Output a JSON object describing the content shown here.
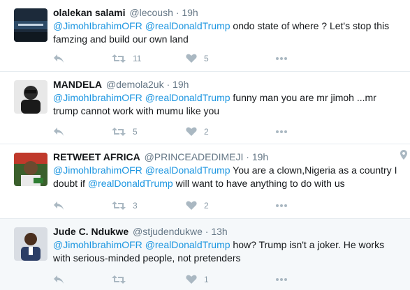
{
  "tweets": [
    {
      "name": "olalekan salami",
      "handle": "@lecoush",
      "time": "19h",
      "mention1": "@JimohIbrahimOFR",
      "mention2": "@realDonaldTrump",
      "text_a": " ondo state of where ? Let's stop this famzing and build our own land",
      "text_b": "",
      "mention3": "",
      "text_c": "",
      "retweets": "11",
      "likes": "5"
    },
    {
      "name": "MANDELA",
      "handle": "@demola2uk",
      "time": "19h",
      "mention1": "@JimohIbrahimOFR",
      "mention2": "@realDonaldTrump",
      "text_a": " funny man you are mr jimoh ...mr trump cannot work with mumu like you",
      "text_b": "",
      "mention3": "",
      "text_c": "",
      "retweets": "5",
      "likes": "2"
    },
    {
      "name": "RETWEET AFRICA",
      "handle": "@PRINCEADEDIMEJI",
      "time": "19h",
      "mention1": "@JimohIbrahimOFR",
      "mention2": "@realDonaldTrump",
      "text_a": " You  are a clown,Nigeria as a country I doubt if ",
      "mention3": "@realDonaldTrump",
      "text_c": " will want to have anything to do with us",
      "retweets": "3",
      "likes": "2"
    },
    {
      "name": "Jude C. Ndukwe",
      "handle": "@stjudendukwe",
      "time": "13h",
      "mention1": "@JimohIbrahimOFR",
      "mention2": "@realDonaldTrump",
      "text_a": " how? Trump isn't a joker. He works with serious-minded people, not pretenders",
      "mention3": "",
      "text_c": "",
      "retweets": "",
      "likes": "1"
    }
  ],
  "separator": "·",
  "icons": {
    "reply": "reply-icon",
    "retweet": "retweet-icon",
    "like": "heart-icon",
    "more": "more-icon",
    "location": "location-pin-icon"
  },
  "colors": {
    "link": "#1b95e0",
    "muted": "#657786",
    "action": "#8899a6",
    "highlight_bg": "#f5f8fa"
  }
}
